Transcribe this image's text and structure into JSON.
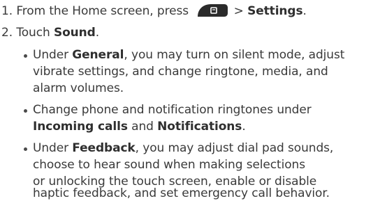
{
  "steps": [
    {
      "number": "1.",
      "text_before_icon": "From the Home screen, press",
      "icon": "menu-key-icon",
      "separator": ">",
      "bold": "Settings",
      "end": "."
    },
    {
      "number": "2.",
      "text": "Touch",
      "bold": "Sound",
      "end": "."
    }
  ],
  "bullets": [
    {
      "lines": [
        {
          "pre": "Under ",
          "bold": "General",
          "post": ", you may turn on silent mode, adjust"
        },
        {
          "pre": "vibrate settings, and change ringtone, media, and"
        },
        {
          "pre": "alarm volumes."
        }
      ]
    },
    {
      "lines": [
        {
          "pre": "Change phone and notification ringtones under"
        },
        {
          "bold": "Incoming calls",
          "post": " and ",
          "bold2": "Notifications",
          "end": "."
        }
      ]
    },
    {
      "lines": [
        {
          "pre": "Under ",
          "bold": "Feedback",
          "post": ", you may adjust dial pad sounds,"
        },
        {
          "pre": "choose to hear sound when making selections"
        },
        {
          "pre": "or unlocking the touch screen, enable or disable"
        },
        {
          "pre": "haptic feedback, and set emergency call behavior."
        }
      ]
    }
  ]
}
